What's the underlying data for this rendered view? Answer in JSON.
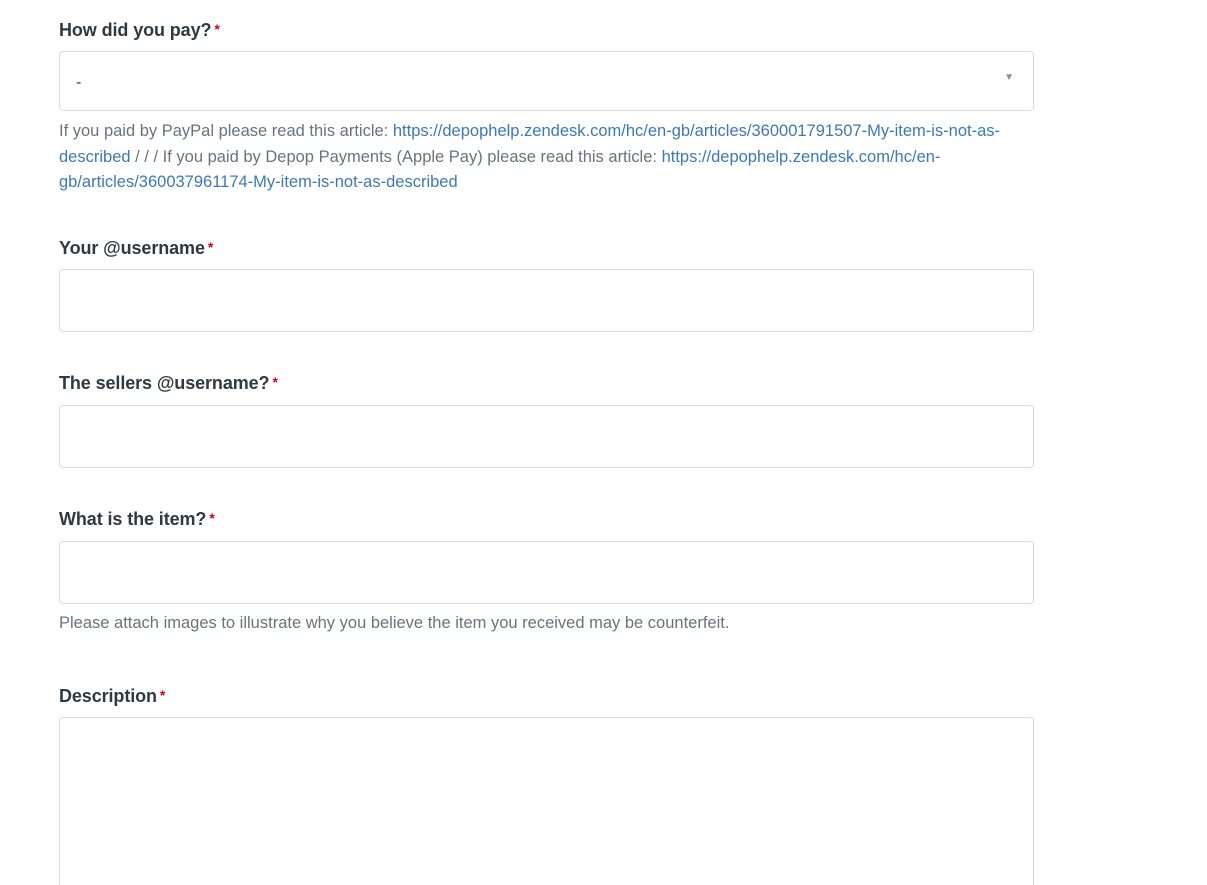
{
  "form": {
    "payment": {
      "label": "How did you pay?",
      "required_mark": "*",
      "selected": "-",
      "hint_prefix": "If you paid by PayPal please read this article: ",
      "hint_link_1": "https://depophelp.zendesk.com/hc/en-gb/articles/360001791507-My-item-is-not-as-described",
      "hint_middle": " / / / If you paid by Depop Payments (Apple Pay) please read this article: ",
      "hint_link_2": "https://depophelp.zendesk.com/hc/en-gb/articles/360037961174-My-item-is-not-as-described"
    },
    "your_username": {
      "label": "Your @username",
      "required_mark": "*",
      "value": ""
    },
    "seller_username": {
      "label": "The sellers @username?",
      "required_mark": "*",
      "value": ""
    },
    "item": {
      "label": "What is the item?",
      "required_mark": "*",
      "value": "",
      "hint": "Please attach images to illustrate why you believe the item you received may be counterfeit."
    },
    "description": {
      "label": "Description",
      "required_mark": "*",
      "value": ""
    }
  },
  "colors": {
    "label": "#2f3941",
    "required": "#d0021b",
    "hint_text": "#68737d",
    "link": "#3c79b4",
    "border": "#d8dcde"
  },
  "icons": {
    "select_arrow": "chevron-down-icon"
  }
}
